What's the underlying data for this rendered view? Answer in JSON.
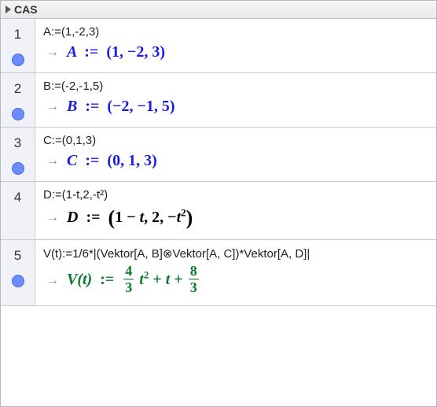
{
  "panel": {
    "title": "CAS"
  },
  "rows": [
    {
      "n": "1",
      "marker": "dot",
      "input": "A:=(1,-2,3)",
      "out": {
        "kind": "blue",
        "lhs": "A",
        "assign": ":=",
        "rhs_tuple": "(1, −2, 3)"
      }
    },
    {
      "n": "2",
      "marker": "dot",
      "input": "B:=(-2,-1,5)",
      "out": {
        "kind": "blue",
        "lhs": "B",
        "assign": ":=",
        "rhs_tuple": "(−2, −1, 5)"
      }
    },
    {
      "n": "3",
      "marker": "dot",
      "input": "C:=(0,1,3)",
      "out": {
        "kind": "blue",
        "lhs": "C",
        "assign": ":=",
        "rhs_tuple": "(0, 1, 3)"
      }
    },
    {
      "n": "4",
      "marker": "none",
      "input": "D:=(1-t,2,-t²)",
      "out": {
        "kind": "black",
        "lhs": "D",
        "assign": ":=",
        "rhs_expr_d": true
      }
    },
    {
      "n": "5",
      "marker": "dot",
      "input": "V(t):=1/6*|(Vektor[A, B]⊗Vektor[A, C])*Vektor[A, D]|",
      "out": {
        "kind": "green",
        "lhs": "V(t)",
        "assign": ":=",
        "rhs_expr_v": true
      }
    }
  ],
  "tokens": {
    "arrow": "→",
    "one": "1",
    "minus": "−",
    "plus": "+",
    "comma": ",",
    "lp": "(",
    "rp": ")",
    "t": "t",
    "two": "2",
    "sq": "2",
    "frac43_n": "4",
    "frac43_d": "3",
    "frac83_n": "8",
    "frac83_d": "3"
  }
}
